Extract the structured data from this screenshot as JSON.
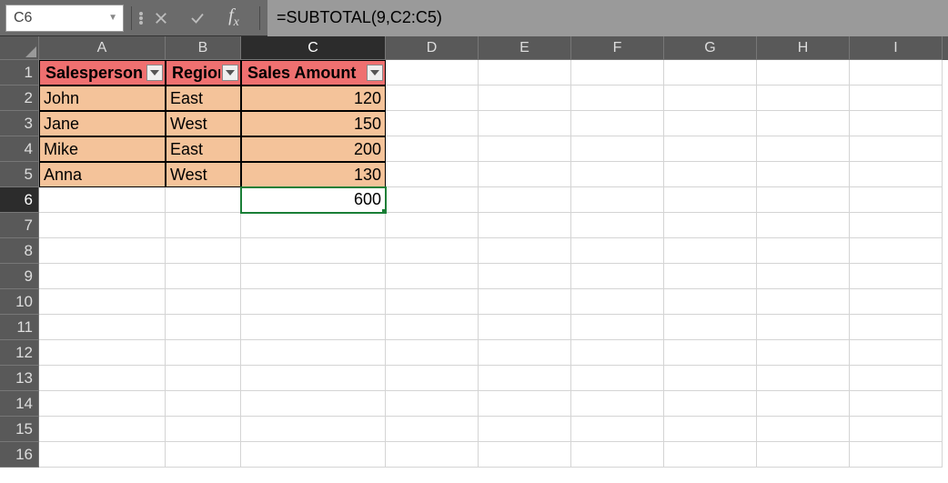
{
  "formula_bar": {
    "cell_ref": "C6",
    "formula": "=SUBTOTAL(9,C2:C5)"
  },
  "columns": [
    "A",
    "B",
    "C",
    "D",
    "E",
    "F",
    "G",
    "H",
    "I"
  ],
  "active_col": "C",
  "active_row": "6",
  "row_count": 16,
  "headers": {
    "A": "Salesperson",
    "B": "Region",
    "C": "Sales Amount"
  },
  "rows": [
    {
      "A": "John",
      "B": "East",
      "C": "120"
    },
    {
      "A": "Jane",
      "B": "West",
      "C": "150"
    },
    {
      "A": "Mike",
      "B": "East",
      "C": "200"
    },
    {
      "A": "Anna",
      "B": "West",
      "C": "130"
    }
  ],
  "subtotal_cell": {
    "row": 6,
    "col": "C",
    "value": "600"
  },
  "chart_data": {
    "type": "table",
    "title": "",
    "columns": [
      "Salesperson",
      "Region",
      "Sales Amount"
    ],
    "records": [
      [
        "John",
        "East",
        120
      ],
      [
        "Jane",
        "West",
        150
      ],
      [
        "Mike",
        "East",
        200
      ],
      [
        "Anna",
        "West",
        130
      ]
    ],
    "subtotal": {
      "function": "SUBTOTAL(9,...)",
      "column": "Sales Amount",
      "value": 600
    }
  }
}
